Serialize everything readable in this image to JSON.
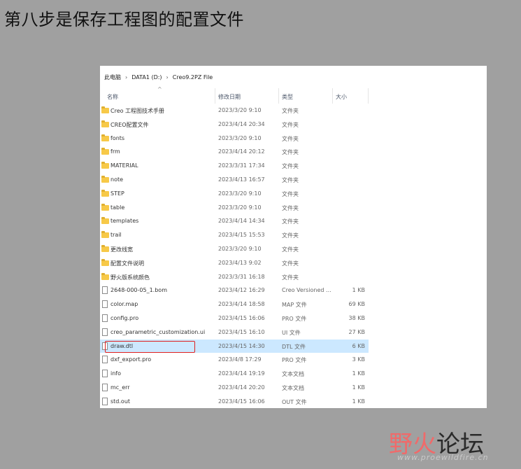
{
  "heading": "第八步是保存工程图的配置文件",
  "breadcrumb": {
    "items": [
      "此电脑",
      "DATA1 (D:)",
      "Creo9.2PZ File"
    ],
    "separator": "›"
  },
  "columns": {
    "name": "名称",
    "modified": "修改日期",
    "type": "类型",
    "size": "大小"
  },
  "files": [
    {
      "name": "Creo 工程图技术手册",
      "date": "2023/3/20 9:10",
      "type": "文件夹",
      "size": "",
      "icon": "folder-icon"
    },
    {
      "name": "CREO配置文件",
      "date": "2023/4/14 20:34",
      "type": "文件夹",
      "size": "",
      "icon": "folder-icon"
    },
    {
      "name": "fonts",
      "date": "2023/3/20 9:10",
      "type": "文件夹",
      "size": "",
      "icon": "folder-icon"
    },
    {
      "name": "frm",
      "date": "2023/4/14 20:12",
      "type": "文件夹",
      "size": "",
      "icon": "folder-icon"
    },
    {
      "name": "MATERIAL",
      "date": "2023/3/31 17:34",
      "type": "文件夹",
      "size": "",
      "icon": "folder-icon"
    },
    {
      "name": "note",
      "date": "2023/4/13 16:57",
      "type": "文件夹",
      "size": "",
      "icon": "folder-icon"
    },
    {
      "name": "STEP",
      "date": "2023/3/20 9:10",
      "type": "文件夹",
      "size": "",
      "icon": "folder-icon"
    },
    {
      "name": "table",
      "date": "2023/3/20 9:10",
      "type": "文件夹",
      "size": "",
      "icon": "folder-icon"
    },
    {
      "name": "templates",
      "date": "2023/4/14 14:34",
      "type": "文件夹",
      "size": "",
      "icon": "folder-icon"
    },
    {
      "name": "trail",
      "date": "2023/4/15 15:53",
      "type": "文件夹",
      "size": "",
      "icon": "folder-icon"
    },
    {
      "name": "更改线宽",
      "date": "2023/3/20 9:10",
      "type": "文件夹",
      "size": "",
      "icon": "folder-icon"
    },
    {
      "name": "配置文件说明",
      "date": "2023/4/13 9:02",
      "type": "文件夹",
      "size": "",
      "icon": "folder-icon"
    },
    {
      "name": "野火版系统颜色",
      "date": "2023/3/31 16:18",
      "type": "文件夹",
      "size": "",
      "icon": "folder-icon"
    },
    {
      "name": "2648-000-05_1.bom",
      "date": "2023/4/12 16:29",
      "type": "Creo Versioned ...",
      "size": "1 KB",
      "icon": "file-icon"
    },
    {
      "name": "color.map",
      "date": "2023/4/14 18:58",
      "type": "MAP 文件",
      "size": "69 KB",
      "icon": "file-icon"
    },
    {
      "name": "config.pro",
      "date": "2023/4/15 16:06",
      "type": "PRO 文件",
      "size": "38 KB",
      "icon": "file-icon"
    },
    {
      "name": "creo_parametric_customization.ui",
      "date": "2023/4/15 16:10",
      "type": "UI 文件",
      "size": "27 KB",
      "icon": "file-icon"
    },
    {
      "name": "draw.dtl",
      "date": "2023/4/15 14:30",
      "type": "DTL 文件",
      "size": "6 KB",
      "icon": "file-icon",
      "selected": true
    },
    {
      "name": "dxf_export.pro",
      "date": "2023/4/8 17:29",
      "type": "PRO 文件",
      "size": "3 KB",
      "icon": "file-icon"
    },
    {
      "name": "info",
      "date": "2023/4/14 19:19",
      "type": "文本文档",
      "size": "1 KB",
      "icon": "file-icon"
    },
    {
      "name": "mc_err",
      "date": "2023/4/14 20:20",
      "type": "文本文档",
      "size": "1 KB",
      "icon": "file-icon"
    },
    {
      "name": "std.out",
      "date": "2023/4/15 16:06",
      "type": "OUT 文件",
      "size": "1 KB",
      "icon": "file-icon"
    }
  ],
  "watermark": {
    "part1": "野火",
    "part2": "论坛",
    "url": "www.proewildfire.cn"
  },
  "colors": {
    "selection": "#cce8ff",
    "highlight": "#e02020",
    "folder": "#f7c948"
  }
}
